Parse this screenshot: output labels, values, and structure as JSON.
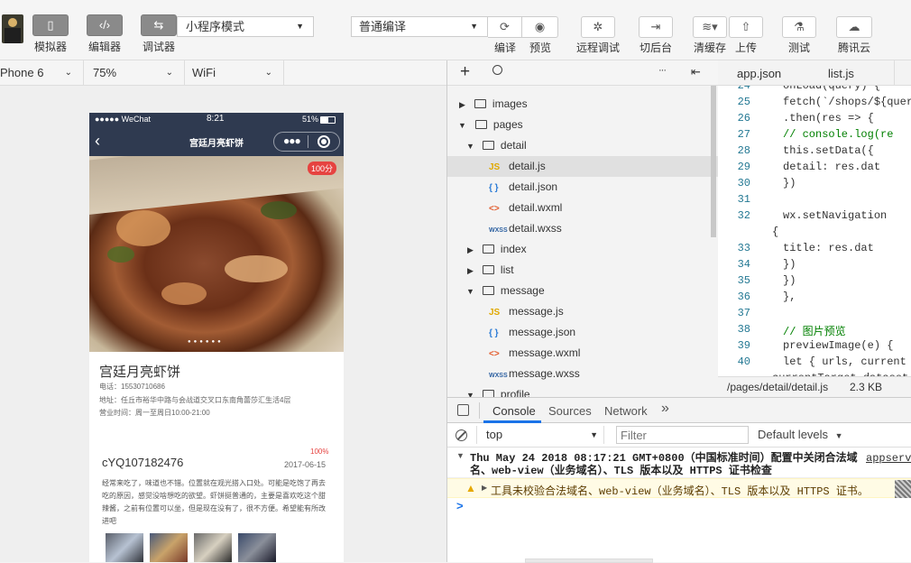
{
  "toolbar": {
    "sim_label": "模拟器",
    "editor_label": "编辑器",
    "debugger_label": "调试器",
    "mode": "小程序模式",
    "compile_mode": "普通编译",
    "compile_label": "编译",
    "preview_label": "预览",
    "remote_label": "远程调试",
    "backend_label": "切后台",
    "clear_cache_label": "清缓存",
    "upload_label": "上传",
    "test_label": "测试",
    "cloud_label": "腾讯云"
  },
  "devbar": {
    "device": "Phone 6",
    "zoom": "75%",
    "network": "WiFi"
  },
  "phone": {
    "carrier": "●●●●● WeChat",
    "time": "8:21",
    "battery": "51%",
    "title": "宫廷月亮虾饼",
    "score": "100分",
    "shop_name": "宫廷月亮虾饼",
    "phone": "电话：15530710686",
    "address": "地址：任丘市裕华中路与会战道交叉口东南角蕾莎汇生活4层",
    "hours": "营业时间：周一至周日10:00-21:00",
    "review_user": "cYQ107182476",
    "review_percent": "100%",
    "review_date": "2017-06-15",
    "review_text": "经常来吃了，味道也不错。位置就在观光搭入口处。可能是吃饱了再去吃的原因，感觉没啥想吃的欲望。虾饼挺普通的，主要是喜欢吃这个甜辣酱，之前有位置可以坐，但是现在没有了，很不方便。希望能有所改进吧"
  },
  "tree": {
    "items": [
      {
        "label": "images",
        "type": "folder",
        "open": false
      },
      {
        "label": "pages",
        "type": "folder",
        "open": true
      },
      {
        "label": "detail",
        "type": "folder",
        "open": true
      },
      {
        "label": "detail.js",
        "type": "JS",
        "icon": "js-icon"
      },
      {
        "label": "detail.json",
        "type": "JSON",
        "icon": "json-icon"
      },
      {
        "label": "detail.wxml",
        "type": "WXML",
        "icon": "wxml-icon"
      },
      {
        "label": "detail.wxss",
        "type": "WXSS",
        "icon": "wxss-icon"
      },
      {
        "label": "index",
        "type": "folder",
        "open": false
      },
      {
        "label": "list",
        "type": "folder",
        "open": false
      },
      {
        "label": "message",
        "type": "folder",
        "open": true
      },
      {
        "label": "message.js",
        "type": "JS",
        "icon": "js-icon"
      },
      {
        "label": "message.json",
        "type": "JSON",
        "icon": "json-icon"
      },
      {
        "label": "message.wxml",
        "type": "WXML",
        "icon": "wxml-icon"
      },
      {
        "label": "message.wxss",
        "type": "WXSS",
        "icon": "wxss-icon"
      },
      {
        "label": "profile",
        "type": "folder",
        "open": true
      }
    ]
  },
  "editor": {
    "tab1": "app.json",
    "tab2": "list.js",
    "lines": [
      {
        "n": "24",
        "t": "onLoad(query) {"
      },
      {
        "n": "25",
        "t": "  fetch(`/shops/${query"
      },
      {
        "n": "26",
        "t": "    .then(res => {"
      },
      {
        "n": "27",
        "t": "      // console.log(re"
      },
      {
        "n": "28",
        "t": "      this.setData({"
      },
      {
        "n": "29",
        "t": "        detail: res.dat"
      },
      {
        "n": "30",
        "t": "      })"
      },
      {
        "n": "31",
        "t": ""
      },
      {
        "n": "32",
        "t": "      wx.setNavigation"
      },
      {
        "n": "",
        "t": "{"
      },
      {
        "n": "33",
        "t": "        title: res.dat"
      },
      {
        "n": "34",
        "t": "      })"
      },
      {
        "n": "35",
        "t": "    })"
      },
      {
        "n": "36",
        "t": "  },"
      },
      {
        "n": "37",
        "t": ""
      },
      {
        "n": "38",
        "t": "  // 图片预览"
      },
      {
        "n": "39",
        "t": "  previewImage(e) {"
      },
      {
        "n": "40",
        "t": "    let { urls, current"
      },
      {
        "n": "",
        "t": "  currentTarget.dataset"
      }
    ],
    "status_path": "/pages/detail/detail.js",
    "status_size": "2.3 KB"
  },
  "console": {
    "tabs": [
      "Console",
      "Sources",
      "Network"
    ],
    "more": "»",
    "context": "top",
    "filter_placeholder": "Filter",
    "levels": "Default levels",
    "log1": "Thu May 24 2018 08:17:21 GMT+0800（中国标准时间）配置中关闭合法域名、web-view（业务域名）、TLS 版本以及 HTTPS 证书检查",
    "log1_source": "appservi",
    "warn": "工具未校验合法域名、web-view（业务域名）、TLS 版本以及 HTTPS 证书。",
    "prompt": ">"
  },
  "colors": {
    "nav": "#2f3a50",
    "accent": "#1aad19",
    "warn_bg": "#fffbe5",
    "badge": "#e64340"
  }
}
